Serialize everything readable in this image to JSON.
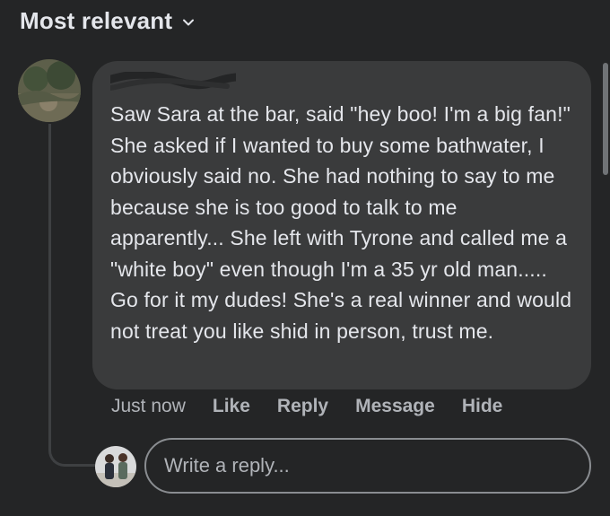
{
  "filter": {
    "label": "Most relevant",
    "icon": "chevron-down-icon"
  },
  "comment": {
    "avatar_icon": "profile-photo-outdoor-scribbled",
    "author_redacted": true,
    "text": "Saw Sara at the bar, said \"hey boo! I'm a big fan!\" She asked if I wanted to buy some bathwater, I obviously said no. She had nothing to say to me because she is too good to talk to me apparently... She left with Tyrone and called me a \"white boy\" even though I'm a 35 yr old man..... Go for it my dudes! She's a real winner and would not treat you like shid in person, trust me.",
    "timestamp": "Just now",
    "actions": {
      "like": "Like",
      "reply": "Reply",
      "message": "Message",
      "hide": "Hide"
    }
  },
  "reply_box": {
    "avatar_icon": "user-avatar-photo",
    "placeholder": "Write a reply..."
  },
  "colors": {
    "background": "#242526",
    "bubble": "#3a3b3c",
    "primary_text": "#e4e6eb",
    "secondary_text": "#b0b3b8",
    "thread_line": "#3e4042"
  }
}
